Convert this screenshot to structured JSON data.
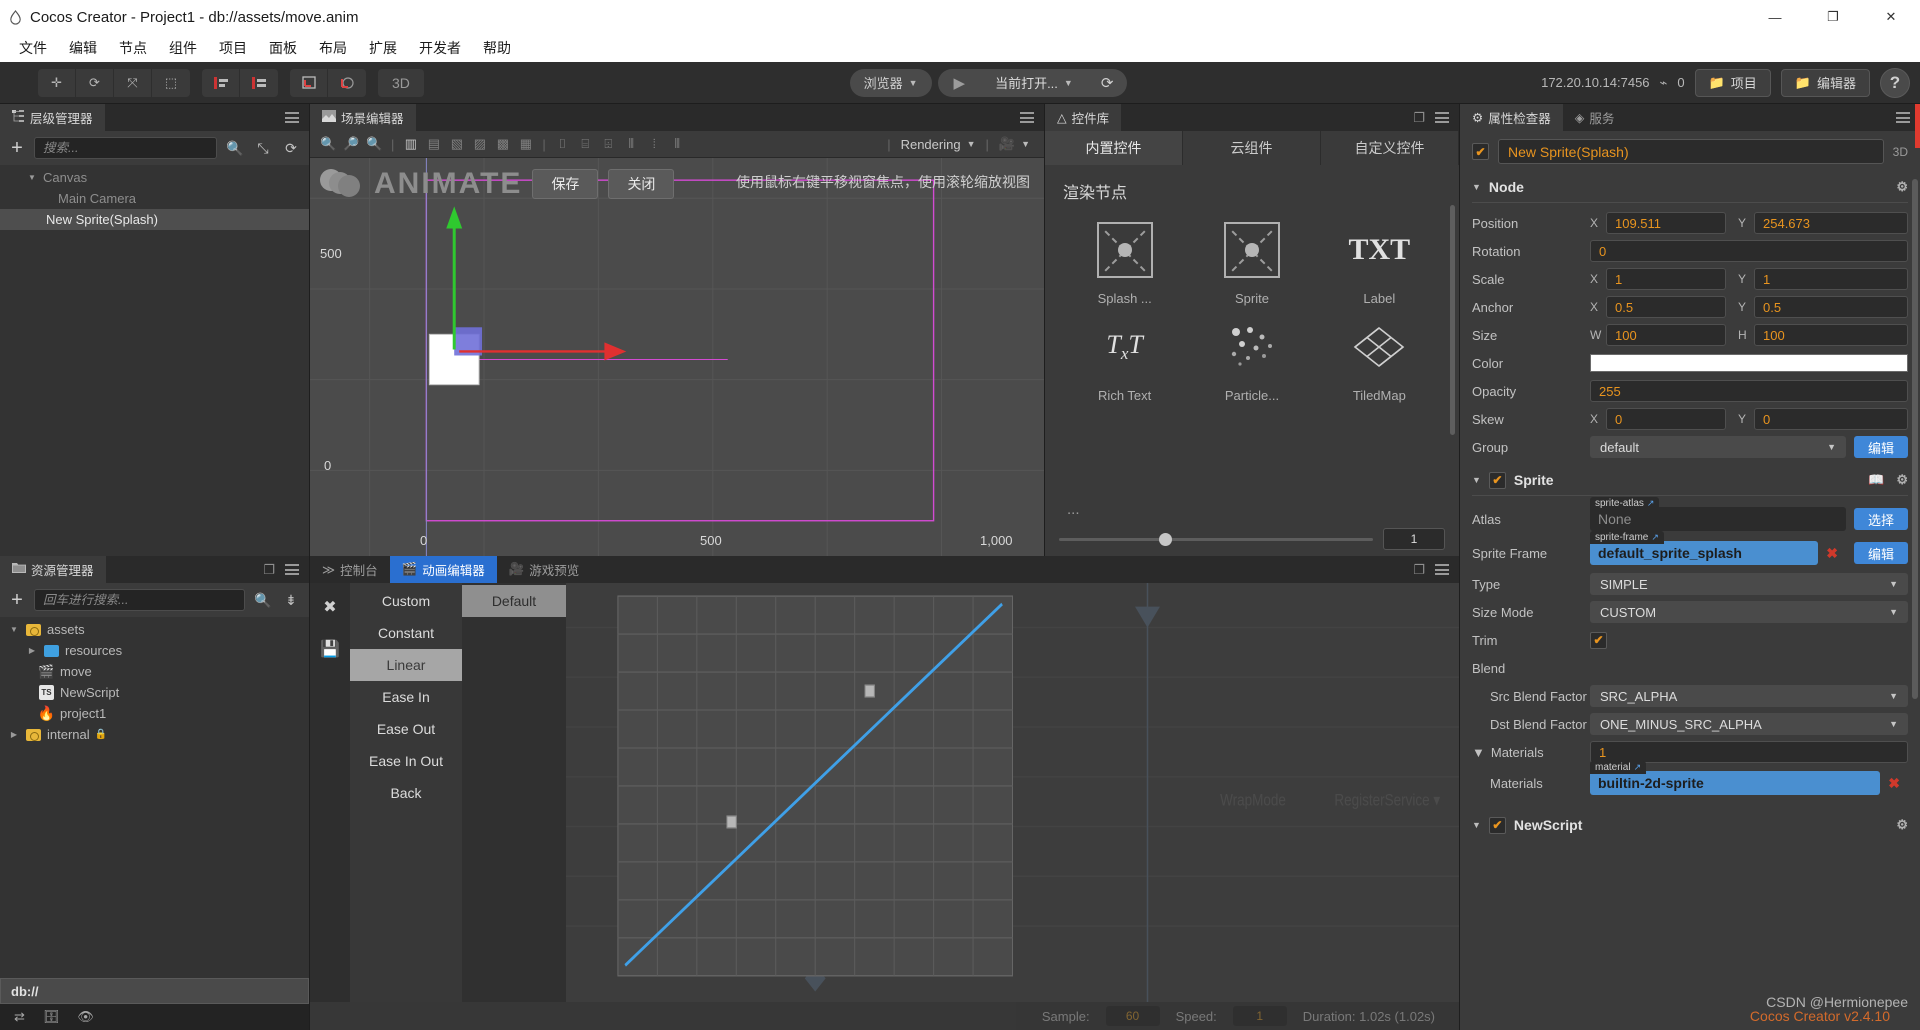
{
  "window": {
    "title": "Cocos Creator - Project1 - db://assets/move.anim",
    "logo_icon": "cocos-logo-icon",
    "minimize_label": "—",
    "maximize_label": "❐",
    "close_label": "✕"
  },
  "menubar": {
    "items": [
      "文件",
      "编辑",
      "节点",
      "组件",
      "项目",
      "面板",
      "布局",
      "扩展",
      "开发者",
      "帮助"
    ]
  },
  "toolbar": {
    "transform_tools": [
      {
        "name": "move-tool",
        "glyph": "✛"
      },
      {
        "name": "rotate-tool",
        "glyph": "⟳"
      },
      {
        "name": "scale-tool",
        "glyph": "⤧"
      },
      {
        "name": "rect-tool",
        "glyph": "⬚"
      }
    ],
    "layout_tools": [
      {
        "name": "align-tool",
        "glyph": "▤"
      },
      {
        "name": "distribute-tool",
        "glyph": "▦"
      }
    ],
    "pivot_tools": [
      {
        "name": "pivot-tool",
        "glyph": "⌐"
      },
      {
        "name": "coord-tool",
        "glyph": "◔"
      }
    ],
    "mode_3d_label": "3D",
    "browser_label": "浏览器",
    "play_label": "▶",
    "open_label": "当前打开...",
    "refresh_label": "⟳",
    "ip_address": "172.20.10.14:7456",
    "wifi_icon": "wifi-icon",
    "device_count": "0",
    "project_button": "项目",
    "editor_button": "编辑器",
    "help_button": "?"
  },
  "hierarchy": {
    "tab_label": "层级管理器",
    "tab_icon": "hierarchy-icon",
    "add_label": "+",
    "search_placeholder": "搜索...",
    "search_value": "",
    "icons": [
      "search-icon",
      "collapse-icon",
      "refresh-icon"
    ],
    "nodes": [
      {
        "label": "Canvas",
        "depth": 1,
        "expanded": true,
        "selected": false,
        "dim": true
      },
      {
        "label": "Main Camera",
        "depth": 2,
        "expanded": false,
        "selected": false,
        "dim": true
      },
      {
        "label": "New Sprite(Splash)",
        "depth": 2,
        "expanded": false,
        "selected": true,
        "dim": false
      }
    ]
  },
  "assets": {
    "tab_label": "资源管理器",
    "tab_icon": "folder-icon",
    "add_label": "+",
    "search_placeholder": "回车进行搜索...",
    "search_value": "",
    "icons": [
      "search-icon",
      "sort-icon"
    ],
    "items": [
      {
        "label": "assets",
        "depth": 0,
        "icon": "folder-yellow",
        "expanded": true,
        "has_twist": true
      },
      {
        "label": "resources",
        "depth": 1,
        "icon": "folder-blue",
        "expanded": false,
        "has_twist": true
      },
      {
        "label": "move",
        "depth": 1,
        "icon": "anim-clip",
        "expanded": false,
        "has_twist": false
      },
      {
        "label": "NewScript",
        "depth": 1,
        "icon": "typescript",
        "expanded": false,
        "has_twist": false
      },
      {
        "label": "project1",
        "depth": 1,
        "icon": "scene-flame",
        "expanded": false,
        "has_twist": false
      },
      {
        "label": "internal",
        "depth": 0,
        "icon": "folder-yellow",
        "expanded": false,
        "has_twist": true,
        "locked": true
      }
    ],
    "path_bar": "db://",
    "status_icons": [
      "sync-icon",
      "database-icon",
      "eye-icon"
    ]
  },
  "scene": {
    "tab_label": "场景编辑器",
    "tab_icon": "scene-icon",
    "toolbar_icons": [
      "zoom-in-icon",
      "zoom-out-icon",
      "zoom-fit-icon",
      "align-left-icon",
      "align-center-h-icon",
      "align-right-icon",
      "align-top-icon",
      "align-middle-icon",
      "align-bottom-icon",
      "distribute-top-icon",
      "distribute-middle-icon",
      "distribute-bottom-icon",
      "dist-h-left-icon",
      "dist-h-center-icon",
      "dist-h-right-icon"
    ],
    "rendering_label": "Rendering",
    "camera_icon": "camera-icon",
    "animate_watermark": "ANIMATE",
    "save_button": "保存",
    "close_button": "关闭",
    "hint": "使用鼠标右键平移视窗焦点，使用滚轮缩放视图",
    "axis_labels": {
      "y_top": "500",
      "origin_y": "0",
      "x_zero": "0",
      "x_mid": "500",
      "x_end": "1,000"
    }
  },
  "widget_library": {
    "tab_label": "控件库",
    "tab_icon": "widget-icon",
    "tabs": [
      {
        "label": "内置控件",
        "active": true
      },
      {
        "label": "云组件",
        "active": false
      },
      {
        "label": "自定义控件",
        "active": false
      }
    ],
    "section_title": "渲染节点",
    "items": [
      {
        "label": "Splash ...",
        "icon": "splash-sprite-icon"
      },
      {
        "label": "Sprite",
        "icon": "sprite-icon"
      },
      {
        "label": "Label",
        "icon": "txt-icon"
      },
      {
        "label": "Rich Text",
        "icon": "rich-text-icon"
      },
      {
        "label": "Particle...",
        "icon": "particle-icon"
      },
      {
        "label": "TiledMap",
        "icon": "tiledmap-icon"
      }
    ],
    "more_label": "...",
    "zoom_value": "1"
  },
  "animation_editor": {
    "tabs": [
      {
        "label": "控制台",
        "icon": "console-icon",
        "active": false
      },
      {
        "label": "动画编辑器",
        "icon": "animation-icon",
        "active": true
      },
      {
        "label": "游戏预览",
        "icon": "game-preview-icon",
        "active": false
      }
    ],
    "rail_icons": [
      "close-icon",
      "save-icon"
    ],
    "ease_menu": [
      {
        "label": "Custom",
        "selected": false
      },
      {
        "label": "Constant",
        "selected": false
      },
      {
        "label": "Linear",
        "selected": true
      },
      {
        "label": "Ease In",
        "selected": false
      },
      {
        "label": "Ease Out",
        "selected": false
      },
      {
        "label": "Ease In Out",
        "selected": false
      },
      {
        "label": "Back",
        "selected": false
      }
    ],
    "ease_submenu": [
      {
        "label": "Default",
        "selected": true
      }
    ],
    "status": {
      "sample_label": "Sample:",
      "sample_value": "60",
      "speed_label": "Speed:",
      "speed_value": "1",
      "duration_label": "Duration: 1.02s (1.02s)"
    },
    "ghost_labels": [
      "WrapMode",
      "RegisterService"
    ]
  },
  "inspector": {
    "tabs": [
      {
        "label": "属性检查器",
        "icon": "gear-icon",
        "active": true
      },
      {
        "label": "服务",
        "icon": "service-icon",
        "active": false
      }
    ],
    "node_enabled": true,
    "node_name": "New Sprite(Splash)",
    "mode_3d_label": "3D",
    "node_section": {
      "title": "Node",
      "gear_icon": "gear-icon",
      "position": {
        "label": "Position",
        "x_axis": "X",
        "x": "109.511",
        "y_axis": "Y",
        "y": "254.673"
      },
      "rotation": {
        "label": "Rotation",
        "value": "0"
      },
      "scale": {
        "label": "Scale",
        "x_axis": "X",
        "x": "1",
        "y_axis": "Y",
        "y": "1"
      },
      "anchor": {
        "label": "Anchor",
        "x_axis": "X",
        "x": "0.5",
        "y_axis": "Y",
        "y": "0.5"
      },
      "size": {
        "label": "Size",
        "w_axis": "W",
        "w": "100",
        "h_axis": "H",
        "h": "100"
      },
      "color": {
        "label": "Color",
        "value": "#FFFFFF"
      },
      "opacity": {
        "label": "Opacity",
        "value": "255"
      },
      "skew": {
        "label": "Skew",
        "x_axis": "X",
        "x": "0",
        "y_axis": "Y",
        "y": "0"
      },
      "group": {
        "label": "Group",
        "value": "default",
        "edit_button": "编辑"
      }
    },
    "sprite_section": {
      "title": "Sprite",
      "enabled": true,
      "help_icon": "book-icon",
      "gear_icon": "gear-icon",
      "atlas": {
        "label": "Atlas",
        "tag": "sprite-atlas",
        "value": "None",
        "filled": false,
        "button": "选择"
      },
      "sprite_frame": {
        "label": "Sprite Frame",
        "tag": "sprite-frame",
        "value": "default_sprite_splash",
        "filled": true,
        "button": "编辑"
      },
      "type": {
        "label": "Type",
        "value": "SIMPLE"
      },
      "size_mode": {
        "label": "Size Mode",
        "value": "CUSTOM"
      },
      "trim": {
        "label": "Trim",
        "checked": true
      },
      "blend": {
        "label": "Blend"
      },
      "src_blend": {
        "label": "Src Blend Factor",
        "value": "SRC_ALPHA"
      },
      "dst_blend": {
        "label": "Dst Blend Factor",
        "value": "ONE_MINUS_SRC_ALPHA"
      },
      "materials_count": {
        "label": "Materials",
        "value": "1"
      },
      "materials": {
        "label": "Materials",
        "tag": "material",
        "value": "builtin-2d-sprite",
        "filled": true
      }
    },
    "script_section": {
      "title": "NewScript",
      "enabled": true,
      "gear_icon": "gear-icon"
    }
  },
  "watermarks": {
    "csdn": "CSDN @Hermionepee",
    "version": "Cocos Creator v2.4.10"
  },
  "colors": {
    "accent_orange": "#e8941f",
    "accent_blue": "#3f87d8",
    "asset_blue": "#4a8fd0",
    "tab_active_blue": "#2a6fd0",
    "panel_bg": "#3b3b3b",
    "dark_bg": "#2b2b2b"
  }
}
